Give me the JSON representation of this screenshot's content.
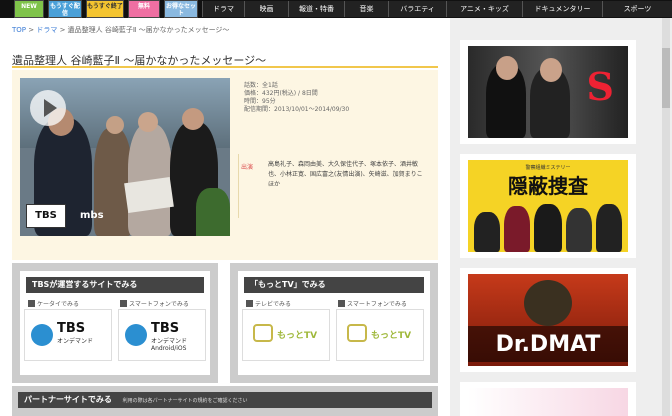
{
  "header": {
    "pills": [
      {
        "label": "NEW",
        "color": "green"
      },
      {
        "label": "もうすぐ配信",
        "color": "blue"
      },
      {
        "label": "もうすぐ終了",
        "color": "yellow"
      },
      {
        "label": "無料",
        "color": "pink"
      },
      {
        "label": "お得なセット",
        "color": "lightblue"
      }
    ],
    "categories": [
      "ドラマ",
      "映画",
      "報道・特番",
      "音楽",
      "バラエティ",
      "アニメ・キッズ",
      "ドキュメンタリー",
      "スポーツ"
    ]
  },
  "breadcrumb": {
    "top": "TOP",
    "drama": "ドラマ",
    "current": "遺品整理人 谷崎藍子Ⅱ 〜届かなかったメッセージ〜"
  },
  "title": "遺品整理人 谷崎藍子Ⅱ 〜届かなかったメッセージ〜",
  "thumbnail": {
    "logo_tbs": "TBS",
    "logo_mbs": "mbs"
  },
  "meta": {
    "line1": "話数：全1話",
    "line2": "価格：432円(税込) / 8日間",
    "line3": "時間：95分",
    "line4": "配信期間：2013/10/01〜2014/09/30"
  },
  "cast": {
    "label": "出演",
    "text": "高島礼子、森岡由美、大久保佳代子、塚本依子、酒井敏也、小林正寛、国広富之(友情出演)、矢崎滋、加賀まりこ ほか"
  },
  "panels": {
    "tbs_title": "TBSが運営するサイトでみる",
    "tbs_sub1": "ケータイでみる",
    "tbs_sub2": "スマートフォンでみる",
    "tbs_card1_big": "TBS",
    "tbs_card1_small": "オンデマンド",
    "tbs_card2_big": "TBS",
    "tbs_card2_small": "オンデマンド Android/iOS",
    "motte_title": "「もっとTV」でみる",
    "motte_sub1": "テレビでみる",
    "motte_sub2": "スマートフォンでみる",
    "motte_card": "もっとTV"
  },
  "partner": {
    "title": "パートナーサイトでみる",
    "note": "利用の際は各パートナーサイトの規約をご確認ください"
  },
  "side": {
    "banner1": "S",
    "banner2_sub": "警察組織ミステリー",
    "banner2": "隠蔽捜査",
    "banner3": "Dr.DMAT"
  }
}
